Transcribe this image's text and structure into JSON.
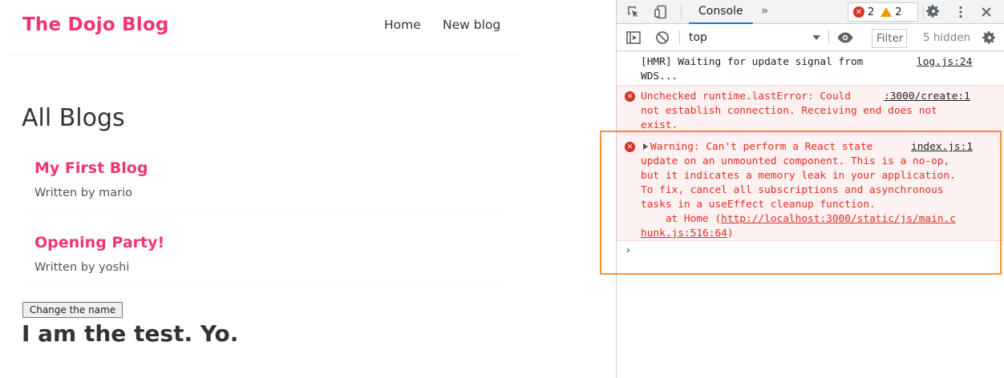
{
  "app": {
    "brand": "The Dojo Blog",
    "nav": [
      "Home",
      "New blog"
    ],
    "heading": "All Blogs",
    "blogs": [
      {
        "title": "My First Blog",
        "author": "Written by mario"
      },
      {
        "title": "Opening Party!",
        "author": "Written by yoshi"
      }
    ],
    "change_button": "Change the name",
    "test_text": "I am the test. Yo."
  },
  "devtools": {
    "tab": "Console",
    "error_count": "2",
    "warning_count": "2",
    "context": "top",
    "filter_placeholder": "Filter",
    "hidden_label": "5 hidden",
    "messages": [
      {
        "level": "info",
        "lines": [
          "[HMR] Waiting for update signal from",
          "WDS..."
        ],
        "source": "log.js:24"
      },
      {
        "level": "error",
        "lines": [
          "Unchecked runtime.lastError: Could",
          "not establish connection. Receiving end does not",
          "exist."
        ],
        "source": ":3000/create:1"
      },
      {
        "level": "error",
        "lines": [
          "Warning: Can't perform a React state",
          "update on an unmounted component. This is a no-op,",
          "but it indicates a memory leak in your application.",
          "To fix, cancel all subscriptions and asynchronous",
          "tasks in a useEffect cleanup function."
        ],
        "stack_prefix": "    at Home (",
        "stack_link_1": "http://localhost:3000/static/js/main.c",
        "stack_link_2": "hunk.js:516:64",
        "stack_suffix": ")",
        "source": "index.js:1"
      }
    ],
    "prompt_symbol": "›"
  },
  "colors": {
    "brand": "#f1356d",
    "error": "#d93025",
    "warning": "#f29900",
    "highlight_box": "#f0943a",
    "devtools_accent": "#1a73e8"
  },
  "icons": [
    "inspect-icon",
    "device-toggle-icon",
    "more-tabs-icon",
    "settings-gear-icon",
    "kebab-menu-icon",
    "close-icon",
    "sidebar-toggle-icon",
    "clear-console-icon",
    "eye-icon",
    "error-icon",
    "warning-icon"
  ]
}
